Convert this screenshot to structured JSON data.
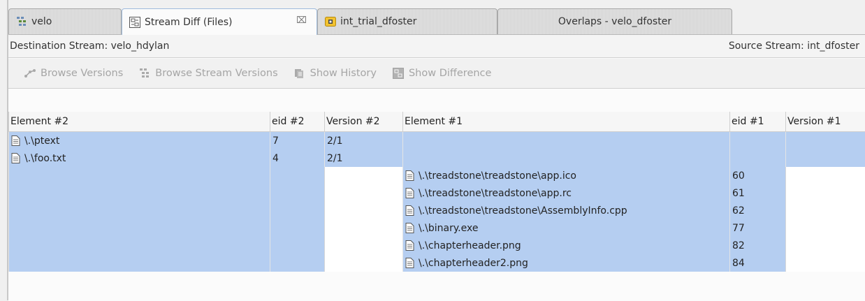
{
  "tabs": [
    {
      "label": "velo",
      "icon": "stream-tree-icon"
    },
    {
      "label": "Stream Diff (Files)",
      "icon": "diff-icon",
      "close": "⌧"
    },
    {
      "label": "int_trial_dfoster",
      "icon": "workspace-icon"
    },
    {
      "label": "Overlaps - velo_dfoster"
    }
  ],
  "streambar": {
    "destination": "Destination Stream: velo_hdylan",
    "source": "Source Stream: int_dfoster"
  },
  "toolbar": {
    "browse_versions": "Browse Versions",
    "browse_stream_versions": "Browse Stream Versions",
    "show_history": "Show History",
    "show_difference": "Show Difference"
  },
  "table": {
    "columns": [
      "Element #2",
      "eid #2",
      "Version #2",
      "Element #1",
      "eid #1",
      "Version #1"
    ],
    "rows": [
      {
        "el2": "\\.\\ptext",
        "eid2": "7",
        "ver2": "2/1",
        "el1": "",
        "eid1": "",
        "ver1": ""
      },
      {
        "el2": "\\.\\foo.txt",
        "eid2": "4",
        "ver2": "2/1",
        "el1": "",
        "eid1": "",
        "ver1": ""
      },
      {
        "el2": "",
        "eid2": "",
        "ver2": "",
        "el1": "\\.\\treadstone\\treadstone\\app.ico",
        "eid1": "60",
        "ver1": ""
      },
      {
        "el2": "",
        "eid2": "",
        "ver2": "",
        "el1": "\\.\\treadstone\\treadstone\\app.rc",
        "eid1": "61",
        "ver1": ""
      },
      {
        "el2": "",
        "eid2": "",
        "ver2": "",
        "el1": "\\.\\treadstone\\treadstone\\AssemblyInfo.cpp",
        "eid1": "62",
        "ver1": ""
      },
      {
        "el2": "",
        "eid2": "",
        "ver2": "",
        "el1": "\\.\\binary.exe",
        "eid1": "77",
        "ver1": ""
      },
      {
        "el2": "",
        "eid2": "",
        "ver2": "",
        "el1": "\\.\\chapterheader.png",
        "eid1": "82",
        "ver1": ""
      },
      {
        "el2": "",
        "eid2": "",
        "ver2": "",
        "el1": "\\.\\chapterheader2.png",
        "eid1": "84",
        "ver1": ""
      }
    ]
  },
  "colors": {
    "selection": "#b5cef1",
    "tab_active_border": "#9fbbdc"
  }
}
